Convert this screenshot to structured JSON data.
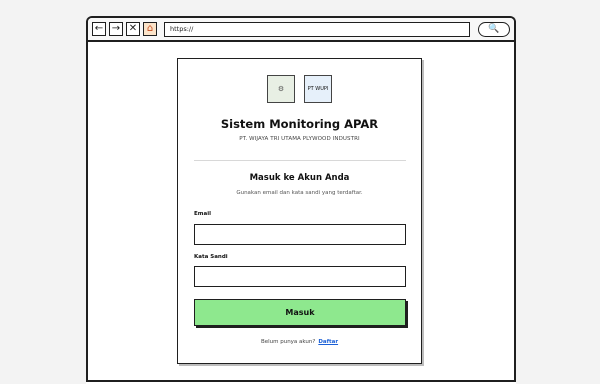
{
  "browser": {
    "back_icon": "←",
    "forward_icon": "→",
    "close_icon": "✕",
    "home_icon": "⌂",
    "url": "https://",
    "search_icon": "🔍"
  },
  "logos": {
    "logo1": "⚙",
    "logo2": "PT WUPI"
  },
  "header": {
    "title": "Sistem Monitoring APAR",
    "company": "PT. WIJAYA TRI UTAMA PLYWOOD INDUSTRI"
  },
  "login": {
    "title": "Masuk ke Akun Anda",
    "subtitle": "Gunakan email dan kata sandi yang terdaftar.",
    "email_label": "Email",
    "email_value": "",
    "password_label": "Kata Sandi",
    "password_value": "",
    "submit_label": "Masuk",
    "footer_text": "Belum punya akun?",
    "register_link": "Daftar"
  },
  "colors": {
    "submit_bg": "#8ee88e",
    "link": "#1a5fd6"
  }
}
